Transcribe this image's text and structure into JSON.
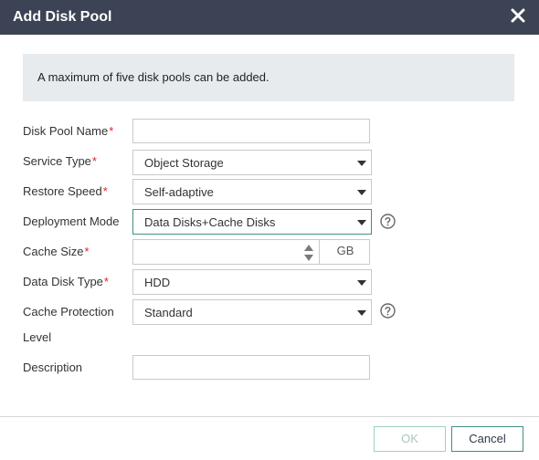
{
  "dialog": {
    "title": "Add Disk Pool",
    "close_icon": "close-icon"
  },
  "notice": "A maximum of five disk pools can be added.",
  "form": {
    "disk_pool_name": {
      "label": "Disk Pool Name",
      "required": "*",
      "value": ""
    },
    "service_type": {
      "label": "Service Type",
      "required": "*",
      "value": "Object Storage"
    },
    "restore_speed": {
      "label": "Restore Speed",
      "required": "*",
      "value": "Self-adaptive"
    },
    "deployment_mode": {
      "label": "Deployment Mode",
      "value": "Data Disks+Cache Disks",
      "help_icon": "help-icon"
    },
    "cache_size": {
      "label": "Cache Size",
      "required": "*",
      "value": "",
      "unit": "GB"
    },
    "data_disk_type": {
      "label": "Data Disk Type",
      "required": "*",
      "value": "HDD"
    },
    "cache_protection_level": {
      "label_line1": "Cache Protection",
      "label_line2": "Level",
      "value": "Standard",
      "help_icon": "help-icon"
    },
    "description": {
      "label": "Description",
      "value": ""
    }
  },
  "footer": {
    "ok_label": "OK",
    "cancel_label": "Cancel"
  },
  "colors": {
    "titlebar": "#3b4354",
    "notice_bg": "#e8ebee",
    "required": "#e0222a",
    "accent": "#3f8f84"
  }
}
